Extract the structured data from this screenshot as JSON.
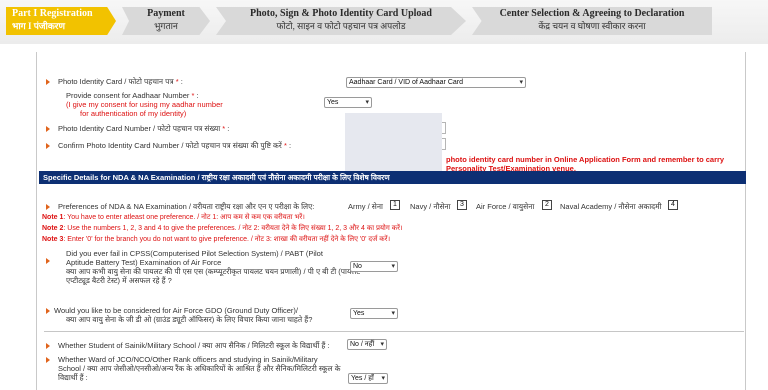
{
  "steps": [
    {
      "en": "Part I Registration",
      "hi": "भाग I पंजीकरण"
    },
    {
      "en": "Payment",
      "hi": "भुगतान"
    },
    {
      "en": "Photo, Sign & Photo Identity Card Upload",
      "hi": "फोटो, साइन व फोटो पहचान पत्र अपलोड"
    },
    {
      "en": "Center Selection & Agreeing to Declaration",
      "hi": "केंद्र चयन व घोषणा स्वीकार करना"
    }
  ],
  "form": {
    "photo_id_label": "Photo Identity Card / फोटो पहचान पत्र",
    "photo_id_value": "Aadhaar Card / VID of Aadhaar Card",
    "consent_label_1": "Provide consent for Aadhaar Number",
    "consent_label_2": "(I give my consent for using my aadhar number",
    "consent_label_3": "for authentication of my identity)",
    "consent_value": "Yes",
    "id_number_label": "Photo Identity Card Number / फोटो पहचान पत्र संख्या",
    "confirm_id_label": "Confirm Photo Identity Card Number / फोटो पहचान पत्र संख्या की पुष्टि करें",
    "warning_1": "photo identity card number in Online Application Form and remember to carry",
    "warning_2": "Personality Test/Examination venue.",
    "required_mark": "*"
  },
  "section_title": "Specific Details for NDA & NA Examination / राष्ट्रीय रक्षा अकादमी एवं नौसेना अकादमी परीक्षा के लिए विशेष विवरण",
  "preferences": {
    "label": "Preferences of NDA & NA Examination / वरीयता राष्ट्रीय रक्षा और एन ए परीक्षा के लिए:",
    "items": [
      {
        "name": "Army / सेना",
        "value": "1"
      },
      {
        "name": "Navy / नौसेना",
        "value": "3"
      },
      {
        "name": "Air Force / वायुसेना",
        "value": "2"
      },
      {
        "name": "Naval Academy / नौसेना अकादमी",
        "value": "4"
      }
    ]
  },
  "notes": [
    {
      "tag": "Note 1",
      "text": ": You have to enter atleast one preference. / नोट 1: आप कम से कम एक वरीयता भरें।"
    },
    {
      "tag": "Note 2",
      "text": ": Use the numbers 1, 2, 3 and 4 to give the preferences. / नोट 2: वरीयता देने के लिए संख्या 1, 2, 3 और 4 का प्रयोग करें।"
    },
    {
      "tag": "Note 3",
      "text": ": Enter '0' for the branch you do not want to give preference. / नोट 3: शाखा की वरीयता नहीं देने के लिए '0' दर्ज करें।"
    }
  ],
  "questions": {
    "cpss_1": "Did you ever fail in CPSS(Computerised Pilot Selection System) / PABT (Pilot",
    "cpss_2": "Aptitude Battery Test) Examination of Air Force",
    "cpss_3": "क्या आप कभी वायु सेना की पायलट की पी एस एस (कम्प्यूटरीकृत पायलट चयन प्रणाली) / पी ए बी टी (पायलट",
    "cpss_4": "एप्टीट्यूड बैटरी टेस्ट) में असफल रहे हैं ?",
    "cpss_value": "No",
    "gdo_1": "Would you like to be considered for Air Force GDO (Ground Duty Officer)/",
    "gdo_2": "क्या आप वायु सेना के जी डी ओ (ग्राउंड ड्यूटी ऑफिसर) के लिए विचार किया जाना चाहते हैं?",
    "gdo_value": "Yes",
    "sainik": "Whether Student of Sainik/Military School / क्या आप सैनिक / मिलिटरी स्कूल के विद्यार्थी हैं :",
    "sainik_value": "No / नहीं",
    "jco_1": "Whether Ward of JCO/NCO/Other Rank officers and studying in Sainik/Military",
    "jco_2": "School / क्या आप जेसीओ/एनसीओ/अन्य रैंक के अधिकारियों के आश्रित हैं और सैनिक/मिलिटरी स्कूल के",
    "jco_3": "विद्यार्थी हैं :",
    "jco_value": "Yes / हाँ"
  }
}
